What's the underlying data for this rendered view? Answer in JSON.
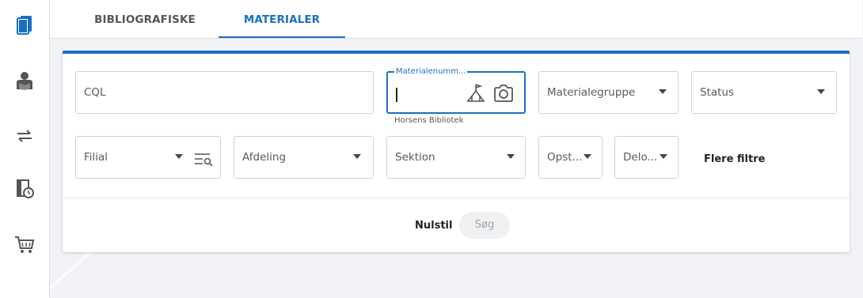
{
  "tabs": [
    {
      "label": "BIBLIOGRAFISKE POSTER",
      "active": false
    },
    {
      "label": "MATERIALER",
      "active": true
    }
  ],
  "sidebar": {
    "items": [
      {
        "icon": "books-icon",
        "accent": "#1a6fc2"
      },
      {
        "icon": "reader-icon"
      },
      {
        "icon": "transfer-arrows-icon"
      },
      {
        "icon": "due-date-book-icon"
      },
      {
        "icon": "cart-icon"
      }
    ]
  },
  "filters": {
    "cql": {
      "placeholder": "CQL"
    },
    "material_number": {
      "label": "Materialenumm...",
      "value": "",
      "helper": "Horsens Bibliotek"
    },
    "material_group": {
      "label": "Materialegruppe"
    },
    "status": {
      "label": "Status"
    },
    "branch": {
      "label": "Filial"
    },
    "department": {
      "label": "Afdeling"
    },
    "section": {
      "label": "Sektion"
    },
    "shelf": {
      "label": "Opst..."
    },
    "sublocation": {
      "label": "Delo..."
    },
    "more_filters": "Flere filtre"
  },
  "actions": {
    "reset": "Nulstil",
    "search": "Søg"
  },
  "colors": {
    "accent": "#1a6fc2",
    "background": "#f0f2f5",
    "disabled_button": "#eef0f2"
  }
}
